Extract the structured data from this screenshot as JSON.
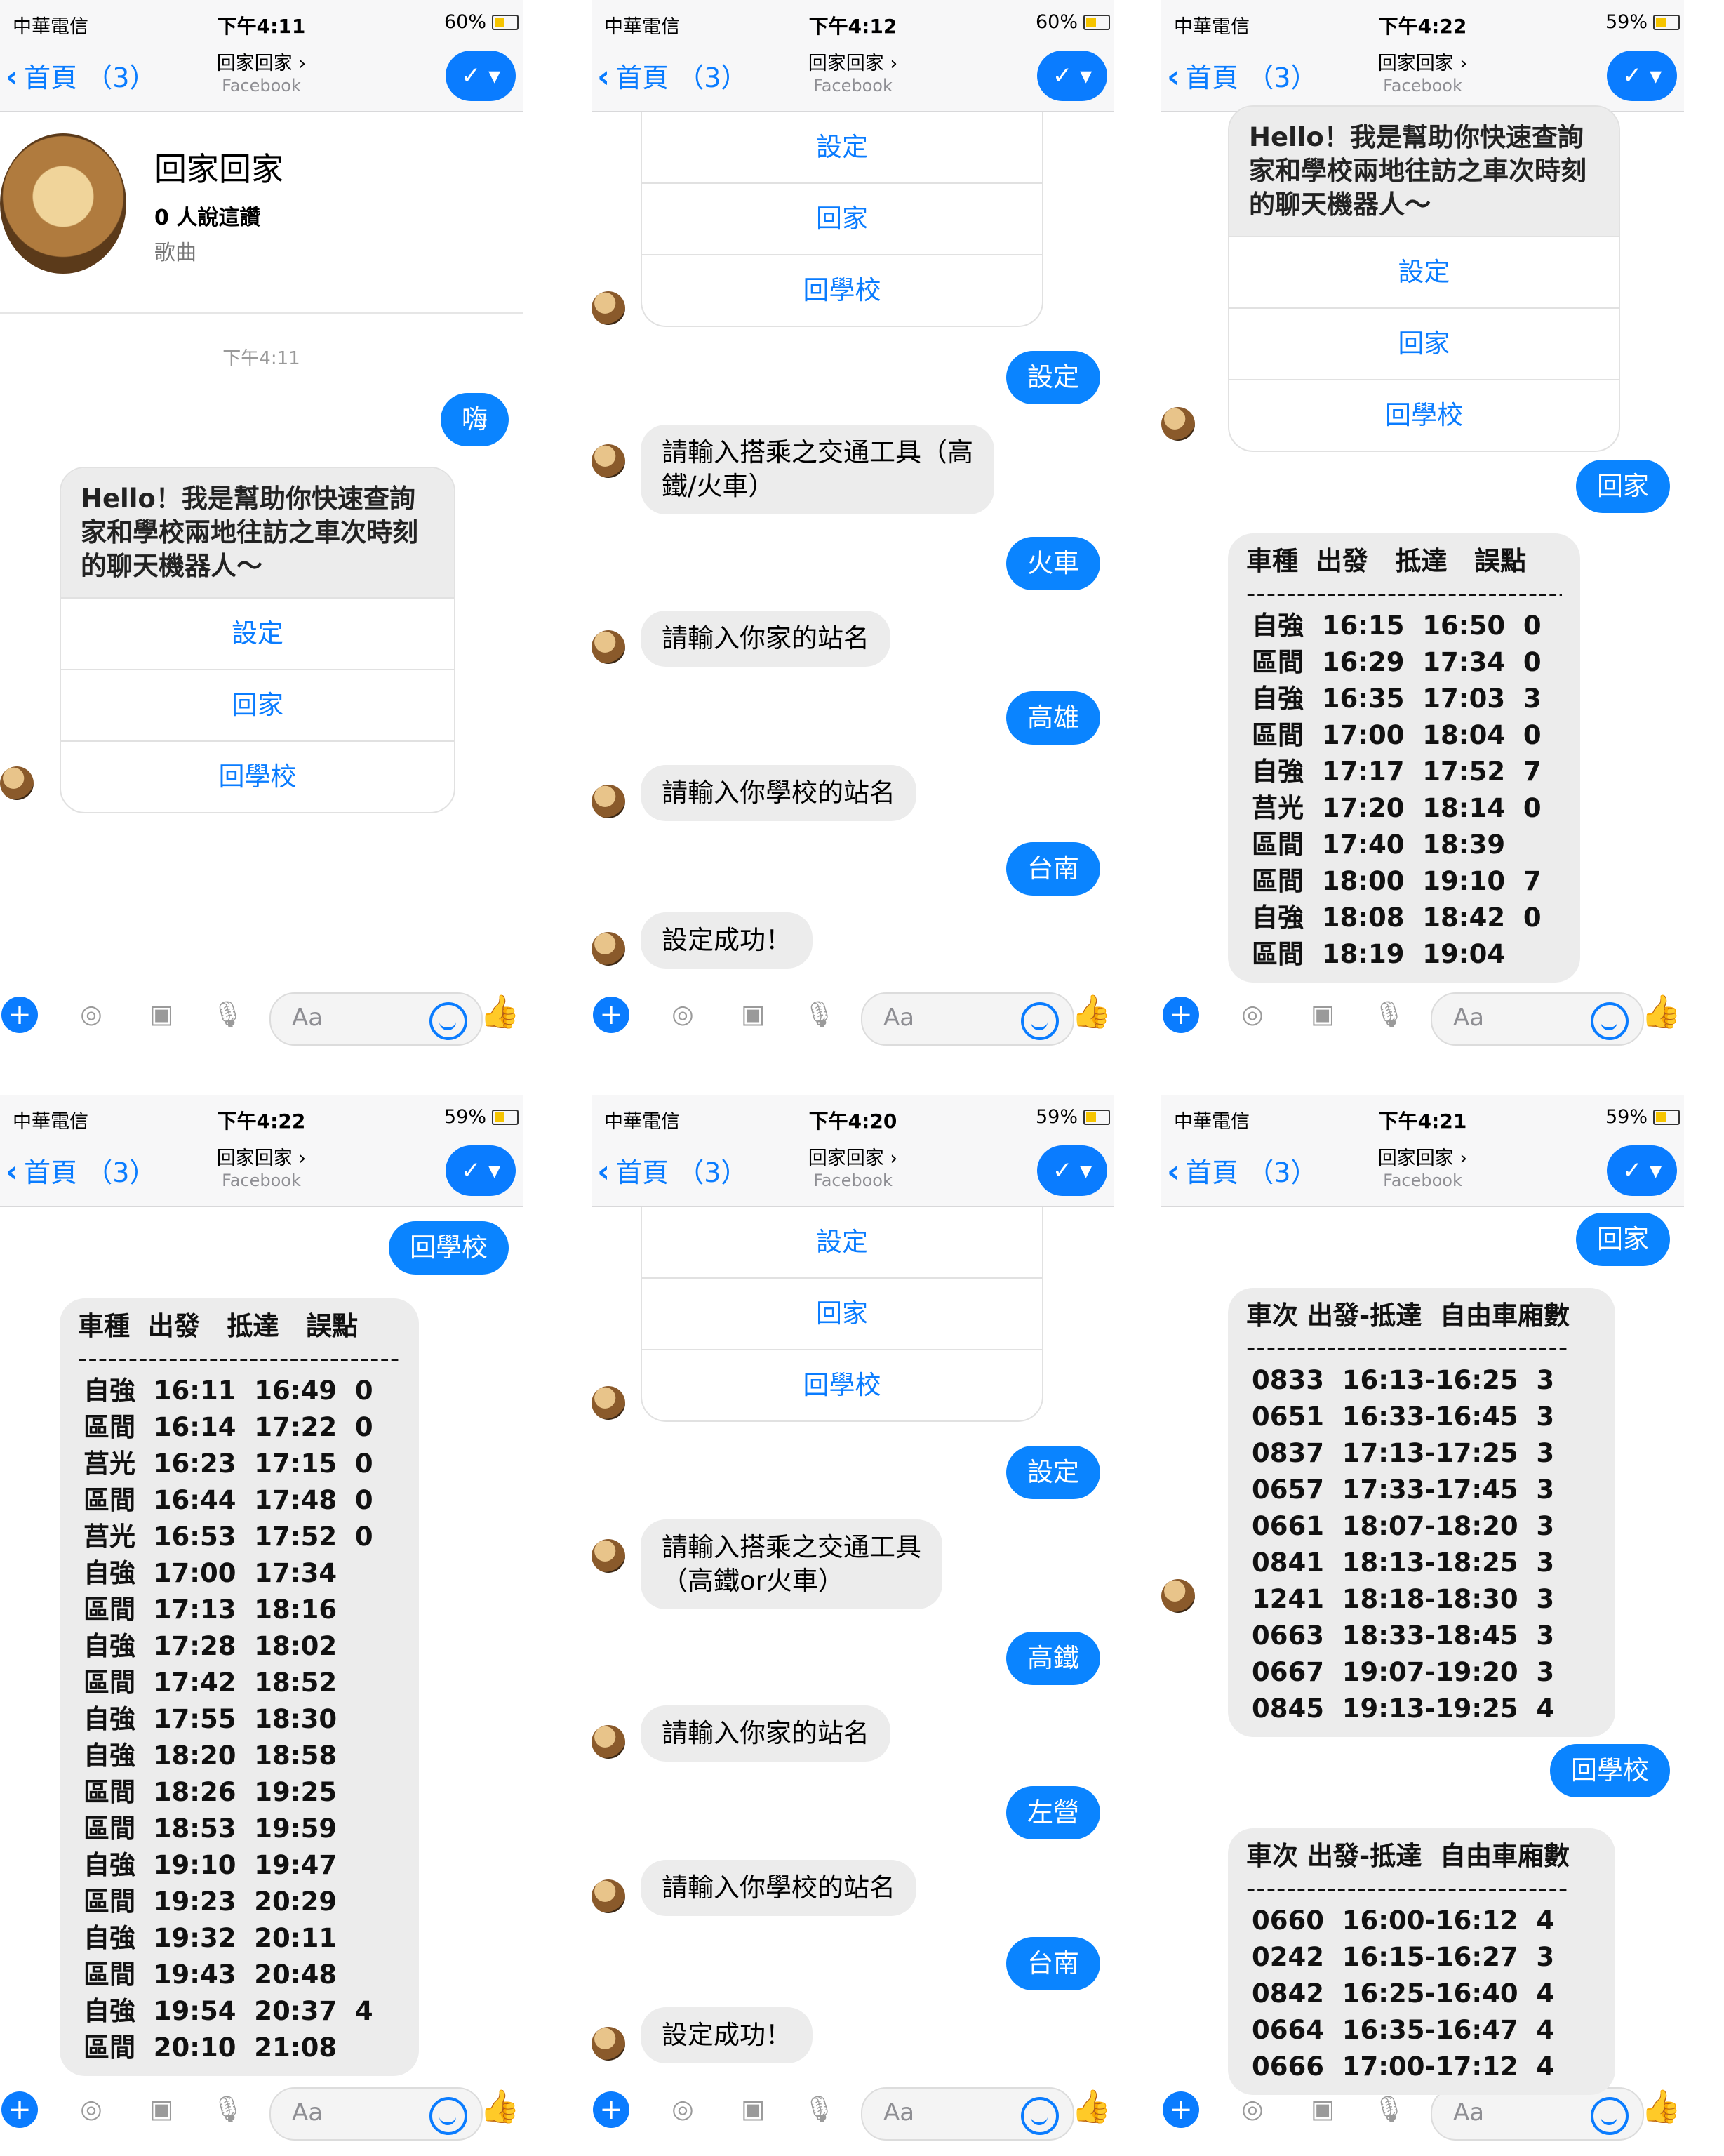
{
  "status_bars": [
    {
      "carrier": "中華電信",
      "time": "下午4:11",
      "battery": "60%"
    },
    {
      "carrier": "中華電信",
      "time": "下午4:12",
      "battery": "60%"
    },
    {
      "carrier": "中華電信",
      "time": "下午4:22",
      "battery": "59%"
    },
    {
      "carrier": "中華電信",
      "time": "下午4:22",
      "battery": "59%"
    },
    {
      "carrier": "中華電信",
      "time": "下午4:20",
      "battery": "59%"
    },
    {
      "carrier": "中華電信",
      "time": "下午4:21",
      "battery": "59%"
    }
  ],
  "nav": {
    "back": "首頁 （3）",
    "title": "回家回家 ›",
    "subtitle": "Facebook",
    "check": "✓ ▾"
  },
  "input": {
    "placeholder": "Aa",
    "plus": "+"
  },
  "profile": {
    "name": "回家回家",
    "likes": "0 人說這讚",
    "category": "歌曲",
    "timestamp": "下午4:11"
  },
  "intro": "Hello！我是幫助你快速查詢\n家和學校兩地往訪之車次時刻\n的聊天機器人～",
  "menu": [
    "設定",
    "回家",
    "回學校"
  ],
  "panel0": {
    "user_msg": "嗨"
  },
  "panel1": {
    "messages": [
      {
        "side": "out",
        "text": "設定"
      },
      {
        "side": "in",
        "text": "請輸入搭乘之交通工具（高\n鐵/火車）"
      },
      {
        "side": "out",
        "text": "火車"
      },
      {
        "side": "in",
        "text": "請輸入你家的站名"
      },
      {
        "side": "out",
        "text": "高雄"
      },
      {
        "side": "in",
        "text": "請輸入你學校的站名"
      },
      {
        "side": "out",
        "text": "台南"
      },
      {
        "side": "in",
        "text": "設定成功！"
      }
    ]
  },
  "panel2": {
    "user_msg": "回家",
    "table_header": "車種  出發   抵達   誤點",
    "rows": [
      "自強  16:15  16:50  0",
      "區間  16:29  17:34  0",
      "自強  16:35  17:03  3",
      "區間  17:00  18:04  0",
      "自強  17:17  17:52  7",
      "莒光  17:20  18:14  0",
      "區間  17:40  18:39",
      "區間  18:00  19:10  7",
      "自強  18:08  18:42  0",
      "區間  18:19  19:04"
    ]
  },
  "panel3": {
    "user_msg": "回學校",
    "table_header": "車種  出發   抵達   誤點",
    "rows": [
      "自強  16:11  16:49  0",
      "區間  16:14  17:22  0",
      "莒光  16:23  17:15  0",
      "區間  16:44  17:48  0",
      "莒光  16:53  17:52  0",
      "自強  17:00  17:34",
      "區間  17:13  18:16",
      "自強  17:28  18:02",
      "區間  17:42  18:52",
      "自強  17:55  18:30",
      "自強  18:20  18:58",
      "區間  18:26  19:25",
      "區間  18:53  19:59",
      "自強  19:10  19:47",
      "區間  19:23  20:29",
      "自強  19:32  20:11",
      "區間  19:43  20:48",
      "自強  19:54  20:37  4",
      "區間  20:10  21:08"
    ]
  },
  "panel4": {
    "messages": [
      {
        "side": "out",
        "text": "設定"
      },
      {
        "side": "in",
        "text": "請輸入搭乘之交通工具\n（高鐵or火車）"
      },
      {
        "side": "out",
        "text": "高鐵"
      },
      {
        "side": "in",
        "text": "請輸入你家的站名"
      },
      {
        "side": "out",
        "text": "左營"
      },
      {
        "side": "in",
        "text": "請輸入你學校的站名"
      },
      {
        "side": "out",
        "text": "台南"
      },
      {
        "side": "in",
        "text": "設定成功！"
      }
    ]
  },
  "panel5": {
    "user_msg_1": "回家",
    "table1_header": "車次 出發-抵達  自由車廂數",
    "table1_rows": [
      "0833  16:13-16:25  3",
      "0651  16:33-16:45  3",
      "0837  17:13-17:25  3",
      "0657  17:33-17:45  3",
      "0661  18:07-18:20  3",
      "0841  18:13-18:25  3",
      "1241  18:18-18:30  3",
      "0663  18:33-18:45  3",
      "0667  19:07-19:20  3",
      "0845  19:13-19:25  4"
    ],
    "user_msg_2": "回學校",
    "table2_header": "車次 出發-抵達  自由車廂數",
    "table2_rows": [
      "0660  16:00-16:12  4",
      "0242  16:15-16:27  3",
      "0842  16:25-16:40  4",
      "0664  16:35-16:47  4",
      "0666  17:00-17:12  4"
    ]
  },
  "dash": "--------------------------------"
}
